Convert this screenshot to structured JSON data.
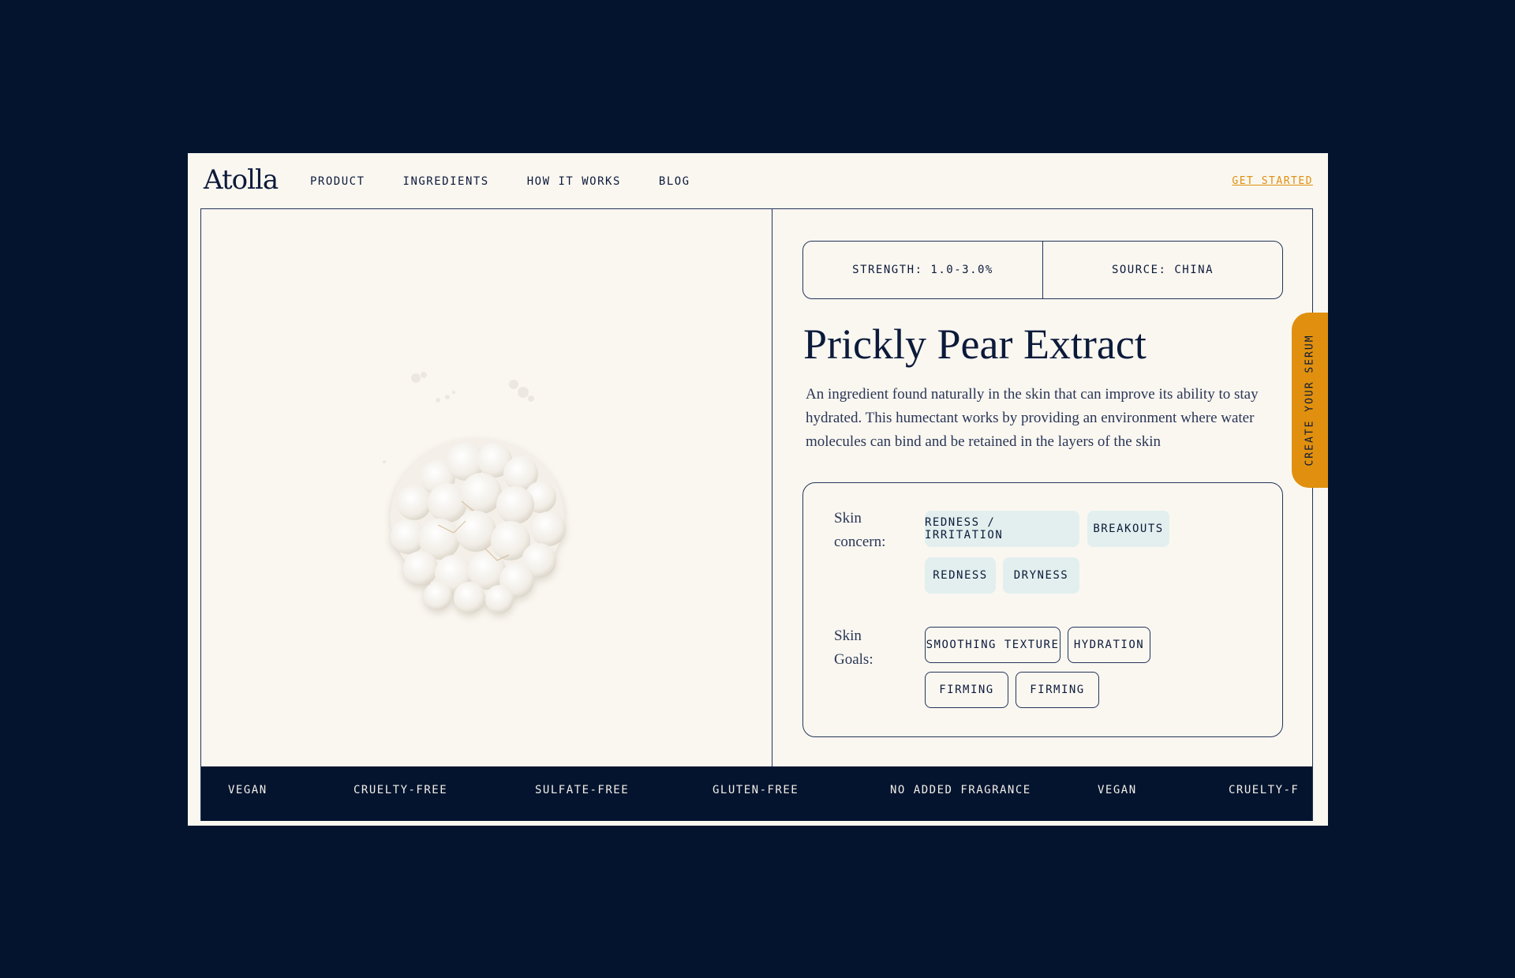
{
  "header": {
    "logo": "Atolla",
    "nav": [
      "PRODUCT",
      "INGREDIENTS",
      "HOW IT WORKS",
      "BLOG"
    ],
    "cta": "GET STARTED"
  },
  "ingredient": {
    "strength": "STRENGTH: 1.0-3.0%",
    "source": "SOURCE: CHINA",
    "title": "Prickly Pear Extract",
    "description": "An ingredient found naturally in the skin that can improve its ability to stay hydrated. This humectant works by providing an environment where water molecules can bind and be retained in the layers of the skin"
  },
  "skin_concern": {
    "label_line1": "Skin",
    "label_line2": "concern:",
    "tags": [
      "REDNESS / IRRITATION",
      "BREAKOUTS",
      "REDNESS",
      "DRYNESS"
    ]
  },
  "skin_goals": {
    "label_line1": "Skin",
    "label_line2": "Goals:",
    "tags": [
      "SMOOTHING TEXTURE",
      "HYDRATION",
      "FIRMING",
      "FIRMING"
    ]
  },
  "side_tab": "CREATE YOUR SERUM",
  "marquee": [
    "VEGAN",
    "CRUELTY-FREE",
    "SULFATE-FREE",
    "GLUTEN-FREE",
    "NO ADDED FRAGRANCE",
    "VEGAN",
    "CRUELTY-F"
  ],
  "colors": {
    "background": "#04142f",
    "panel": "#faf7f1",
    "ink": "#0c1a3a",
    "accent": "#e0900e",
    "tag_fill": "#e2efee"
  },
  "image": {
    "icon": "white-powder-cluster-image"
  }
}
